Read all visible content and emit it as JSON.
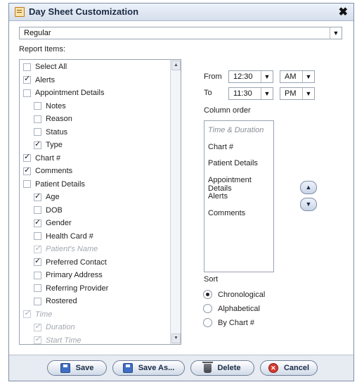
{
  "dialog": {
    "title": "Day Sheet Customization",
    "close_glyph": "✖",
    "template_select": {
      "value": "Regular"
    }
  },
  "report_items": {
    "label": "Report Items:",
    "items": [
      {
        "label": "Select All",
        "checked": false,
        "disabled": false
      },
      {
        "label": "Alerts",
        "checked": true,
        "disabled": false
      },
      {
        "label": "Appointment Details",
        "checked": false,
        "disabled": false
      },
      {
        "label": "Notes",
        "checked": false,
        "disabled": false
      },
      {
        "label": "Reason",
        "checked": false,
        "disabled": false
      },
      {
        "label": "Status",
        "checked": false,
        "disabled": false
      },
      {
        "label": "Type",
        "checked": true,
        "disabled": false
      },
      {
        "label": "Chart #",
        "checked": true,
        "disabled": false
      },
      {
        "label": "Comments",
        "checked": true,
        "disabled": false
      },
      {
        "label": "Patient Details",
        "checked": false,
        "disabled": false
      },
      {
        "label": "Age",
        "checked": true,
        "disabled": false
      },
      {
        "label": "DOB",
        "checked": false,
        "disabled": false
      },
      {
        "label": "Gender",
        "checked": true,
        "disabled": false
      },
      {
        "label": "Health Card #",
        "checked": false,
        "disabled": false
      },
      {
        "label": "Patient's Name",
        "checked": true,
        "disabled": true
      },
      {
        "label": "Preferred Contact",
        "checked": true,
        "disabled": false
      },
      {
        "label": "Primary Address",
        "checked": false,
        "disabled": false
      },
      {
        "label": "Referring Provider",
        "checked": false,
        "disabled": false
      },
      {
        "label": "Rostered",
        "checked": false,
        "disabled": false
      },
      {
        "label": "Time",
        "checked": true,
        "disabled": true
      },
      {
        "label": "Duration",
        "checked": true,
        "disabled": true
      },
      {
        "label": "Start Time",
        "checked": true,
        "disabled": true
      }
    ]
  },
  "time_range": {
    "from_label": "From",
    "from_time": "12:30",
    "from_ampm": "AM",
    "to_label": "To",
    "to_time": "11:30",
    "to_ampm": "PM"
  },
  "column_order": {
    "label": "Column order",
    "items": [
      {
        "label": "Time & Duration",
        "disabled": true
      },
      {
        "label": "Chart #",
        "disabled": false
      },
      {
        "label": "Patient Details",
        "disabled": false
      },
      {
        "label": "Appointment Details",
        "disabled": false
      },
      {
        "label": "Alerts",
        "disabled": false
      },
      {
        "label": "Comments",
        "disabled": false
      }
    ],
    "up_glyph": "▲",
    "down_glyph": "▼"
  },
  "sort": {
    "label": "Sort",
    "options": [
      {
        "label": "Chronological",
        "selected": true
      },
      {
        "label": "Alphabetical",
        "selected": false
      },
      {
        "label": "By Chart #",
        "selected": false
      }
    ]
  },
  "footer": {
    "save_label": "Save",
    "save_as_label": "Save As...",
    "delete_label": "Delete",
    "cancel_label": "Cancel"
  },
  "icons": {
    "dropdown": "chevron-down-icon",
    "scroll_up": "scroll-up-icon",
    "scroll_down": "scroll-down-icon",
    "save": "save-icon",
    "delete": "trash-icon",
    "cancel": "cancel-icon"
  }
}
